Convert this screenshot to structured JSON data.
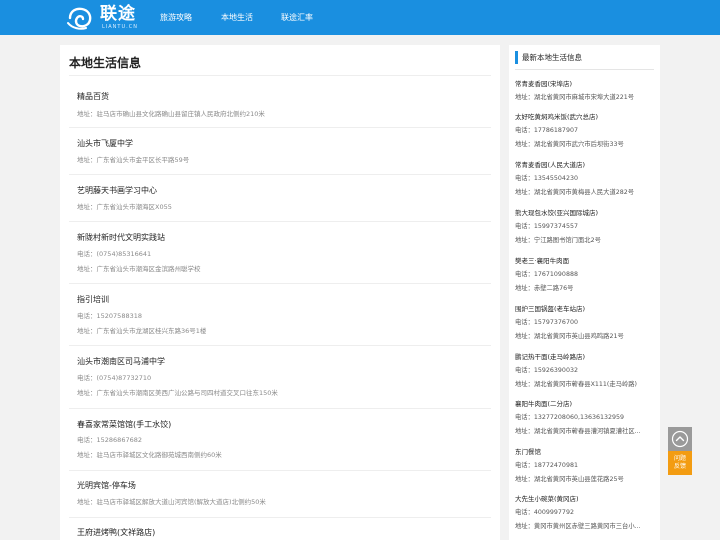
{
  "header": {
    "logo_text": "联途",
    "logo_sub": "LIANTU.CN",
    "nav": [
      "旅游攻略",
      "本地生活",
      "联途汇率"
    ]
  },
  "main": {
    "title": "本地生活信息",
    "items": [
      {
        "name": "精品百货",
        "lines": [
          "地址：驻马店市确山县文化路确山县留庄镇人民政府北侧约210米"
        ]
      },
      {
        "name": "汕头市飞厦中学",
        "lines": [
          "地址：广东省汕头市金平区长平路59号"
        ]
      },
      {
        "name": "艺明藤天书画学习中心",
        "lines": [
          "地址：广东省汕头市潮海区X055"
        ]
      },
      {
        "name": "新陇村新时代文明实践站",
        "lines": [
          "电话：(0754)85316641",
          "地址：广东省汕头市潮海区金滨路州聪学校"
        ]
      },
      {
        "name": "指引培训",
        "lines": [
          "电话：15207588318",
          "地址：广东省汕头市龙湖区桂兴东路36号1楼"
        ]
      },
      {
        "name": "汕头市潮南区司马浦中学",
        "lines": [
          "电话：(0754)87732710",
          "地址：广东省汕头市潮南区美西广汕公路与司四村道交叉口往东150米"
        ]
      },
      {
        "name": "春喜家常菜馆馆(手工水饺)",
        "lines": [
          "电话：15286867682",
          "地址：驻马店市驿城区文化路御苑城西南侧约60米"
        ]
      },
      {
        "name": "光明宾馆-停车场",
        "lines": [
          "地址：驻马店市驿城区解放大道山河宾馆(解放大道店)北侧约50米"
        ]
      },
      {
        "name": "王府进烤鸭(文祥路店)",
        "lines": []
      }
    ]
  },
  "sidebar": {
    "title": "最新本地生活信息",
    "items": [
      {
        "name": "常青麦香园(宋埠店)",
        "lines": [
          "地址：湖北省黄冈市麻城市宋埠大道221号"
        ]
      },
      {
        "name": "太好吃黄焖鸡米饭(武穴总店)",
        "lines": [
          "电话：17786187907",
          "地址：湖北省黄冈市武穴市后坝街33号"
        ]
      },
      {
        "name": "常青麦香园(人民大道店)",
        "lines": [
          "电话：13545504230",
          "地址：湖北省黄冈市黄梅县人民大道282号"
        ]
      },
      {
        "name": "熊大现包水饺(亚兴国际城店)",
        "lines": [
          "电话：15997374557",
          "地址：宁江路图书馆门面北2号"
        ]
      },
      {
        "name": "樊老三·襄阳牛肉面",
        "lines": [
          "电话：17671090888",
          "地址：赤壁二路76号"
        ]
      },
      {
        "name": "围炉三国锅盔(老车站店)",
        "lines": [
          "电话：15797376700",
          "地址：湖北省黄冈市英山县鸡鸣路21号"
        ]
      },
      {
        "name": "鹏记热干面(走马岭路店)",
        "lines": [
          "电话：15926390032",
          "地址：湖北省黄冈市蕲春县X111(走马岭路)"
        ]
      },
      {
        "name": "襄阳牛肉面(二分店)",
        "lines": [
          "电话：13277208060,13636132959",
          "地址：湖北省黄冈市蕲春县漕河镇夏漕社区..."
        ]
      },
      {
        "name": "东门餐馆",
        "lines": [
          "电话：18772470981",
          "地址：湖北省黄冈市英山县莲花路25号"
        ]
      },
      {
        "name": "大先生小碗菜(黄冈店)",
        "lines": [
          "电话：4009997792",
          "地址：黄冈市黄州区赤壁三路黄冈市三台小..."
        ]
      }
    ]
  },
  "floating": {
    "top_icon": "arrow-up-icon",
    "feedback": [
      "问题",
      "反馈"
    ]
  },
  "colors": {
    "brand": "#1a8fe0",
    "feedback": "#f39c12",
    "background": "#f2f2f2"
  }
}
